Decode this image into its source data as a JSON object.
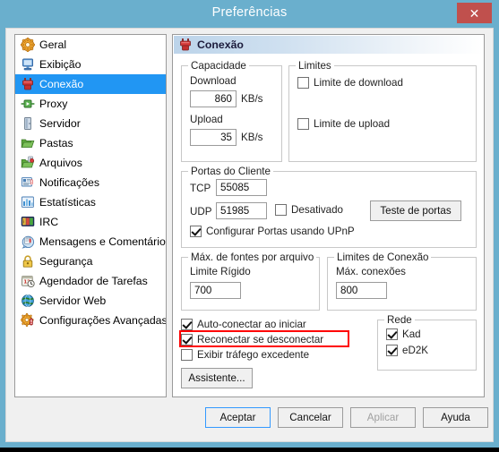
{
  "window": {
    "title": "Preferências",
    "close_label": "✕",
    "titlebar_color": "#6aafcd",
    "close_button_color": "#c0504d",
    "accent_color": "#2196f3",
    "highlight_color": "#ff0000"
  },
  "sidebar": {
    "items": [
      {
        "label": "Geral",
        "icon": "gear-icon",
        "selected": false
      },
      {
        "label": "Exibição",
        "icon": "monitor-icon",
        "selected": false
      },
      {
        "label": "Conexão",
        "icon": "plug-icon",
        "selected": true
      },
      {
        "label": "Proxy",
        "icon": "proxy-icon",
        "selected": false
      },
      {
        "label": "Servidor",
        "icon": "server-icon",
        "selected": false
      },
      {
        "label": "Pastas",
        "icon": "folder-icon",
        "selected": false
      },
      {
        "label": "Arquivos",
        "icon": "files-icon",
        "selected": false
      },
      {
        "label": "Notificações",
        "icon": "notification-icon",
        "selected": false
      },
      {
        "label": "Estatísticas",
        "icon": "statistics-icon",
        "selected": false
      },
      {
        "label": "IRC",
        "icon": "irc-icon",
        "selected": false
      },
      {
        "label": "Mensagens e Comentários",
        "icon": "message-icon",
        "selected": false
      },
      {
        "label": "Segurança",
        "icon": "lock-icon",
        "selected": false
      },
      {
        "label": "Agendador de Tarefas",
        "icon": "calendar-icon",
        "selected": false
      },
      {
        "label": "Servidor Web",
        "icon": "globe-icon",
        "selected": false
      },
      {
        "label": "Configurações Avançadas",
        "icon": "advanced-gear-icon",
        "selected": false
      }
    ]
  },
  "panel": {
    "header": {
      "title": "Conexão",
      "icon": "plug-icon"
    },
    "capacity": {
      "legend": "Capacidade",
      "download_label": "Download",
      "download_value": "860",
      "download_unit": "KB/s",
      "upload_label": "Upload",
      "upload_value": "35",
      "upload_unit": "KB/s"
    },
    "limits": {
      "legend": "Limites",
      "download_limit_label": "Limite de download",
      "download_limit_checked": false,
      "upload_limit_label": "Limite de upload",
      "upload_limit_checked": false
    },
    "client_ports": {
      "legend": "Portas do Cliente",
      "tcp_label": "TCP",
      "tcp_value": "55085",
      "udp_label": "UDP",
      "udp_value": "51985",
      "disabled_label": "Desativado",
      "disabled_checked": false,
      "upnp_label": "Configurar Portas usando UPnP",
      "upnp_checked": true,
      "port_test_button": "Teste de portas"
    },
    "max_sources": {
      "legend": "Máx. de fontes por arquivo",
      "hard_limit_label": "Limite Rígido",
      "hard_limit_value": "700"
    },
    "connection_limits": {
      "legend": "Limites de Conexão",
      "max_connections_label": "Máx. conexões",
      "max_connections_value": "800"
    },
    "options": {
      "autoconnect_label": "Auto-conectar ao iniciar",
      "autoconnect_checked": true,
      "reconnect_label": "Reconectar se desconectar",
      "reconnect_checked": true,
      "reconnect_highlighted": true,
      "show_overhead_label": "Exibir tráfego excedente",
      "show_overhead_checked": false,
      "wizard_button": "Assistente..."
    },
    "network": {
      "legend": "Rede",
      "kad_label": "Kad",
      "kad_checked": true,
      "ed2k_label": "eD2K",
      "ed2k_checked": true
    }
  },
  "footer": {
    "accept": "Aceptar",
    "cancel": "Cancelar",
    "apply": "Aplicar",
    "apply_disabled": true,
    "help": "Ayuda"
  }
}
